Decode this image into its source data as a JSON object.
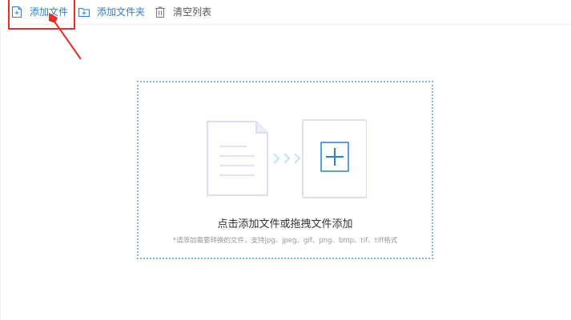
{
  "toolbar": {
    "add_file_label": "添加文件",
    "add_folder_label": "添加文件夹",
    "clear_list_label": "清空列表",
    "icons": {
      "add_file": "file-plus-icon",
      "add_folder": "folder-plus-icon",
      "clear_list": "trash-icon"
    }
  },
  "drop_zone": {
    "title": "点击添加文件或拖拽文件添加",
    "hint": "*请添加需要转换的文件，支持jpg、jpeg、gif、png、bmp、tif、tiff格式"
  },
  "colors": {
    "accent": "#2f7fcf",
    "highlight": "#e0302a",
    "dashed_border": "#7fb2dd"
  }
}
